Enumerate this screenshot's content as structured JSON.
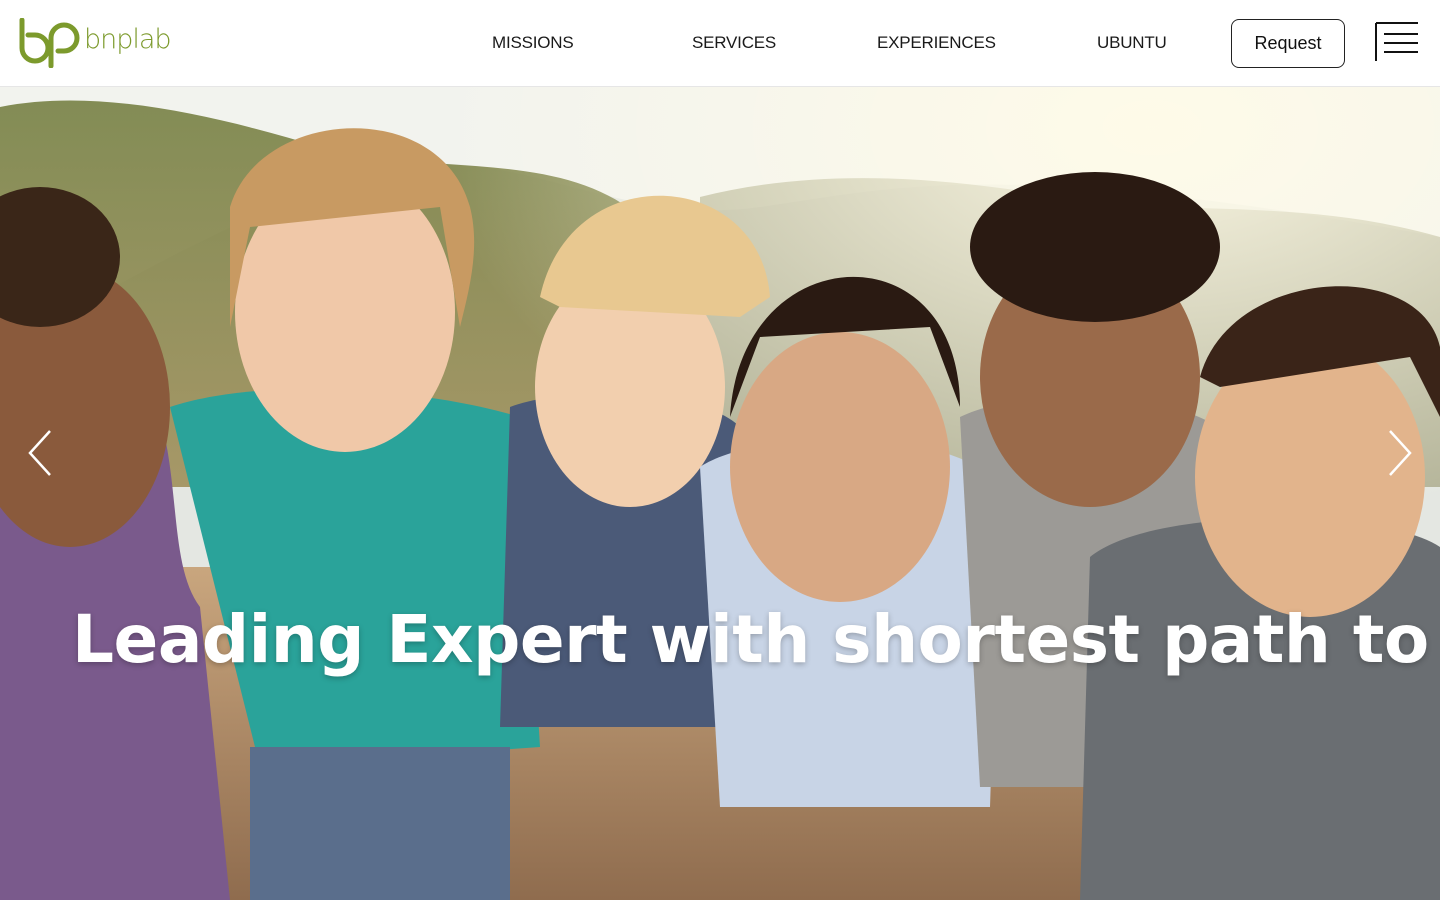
{
  "brand": {
    "name": "bnplab",
    "accent": "#7c9a2c"
  },
  "nav": {
    "items": [
      {
        "label": "MISSIONS"
      },
      {
        "label": "SERVICES"
      },
      {
        "label": "EXPERIENCES"
      },
      {
        "label": "UBUNTU"
      }
    ],
    "request_label": "Request",
    "menu_icon": "hamburger-menu-icon"
  },
  "hero": {
    "title": "Leading Expert with shortest path to IND",
    "image": "smiling-children-group-photo",
    "prev_icon": "chevron-left-icon",
    "next_icon": "chevron-right-icon"
  }
}
